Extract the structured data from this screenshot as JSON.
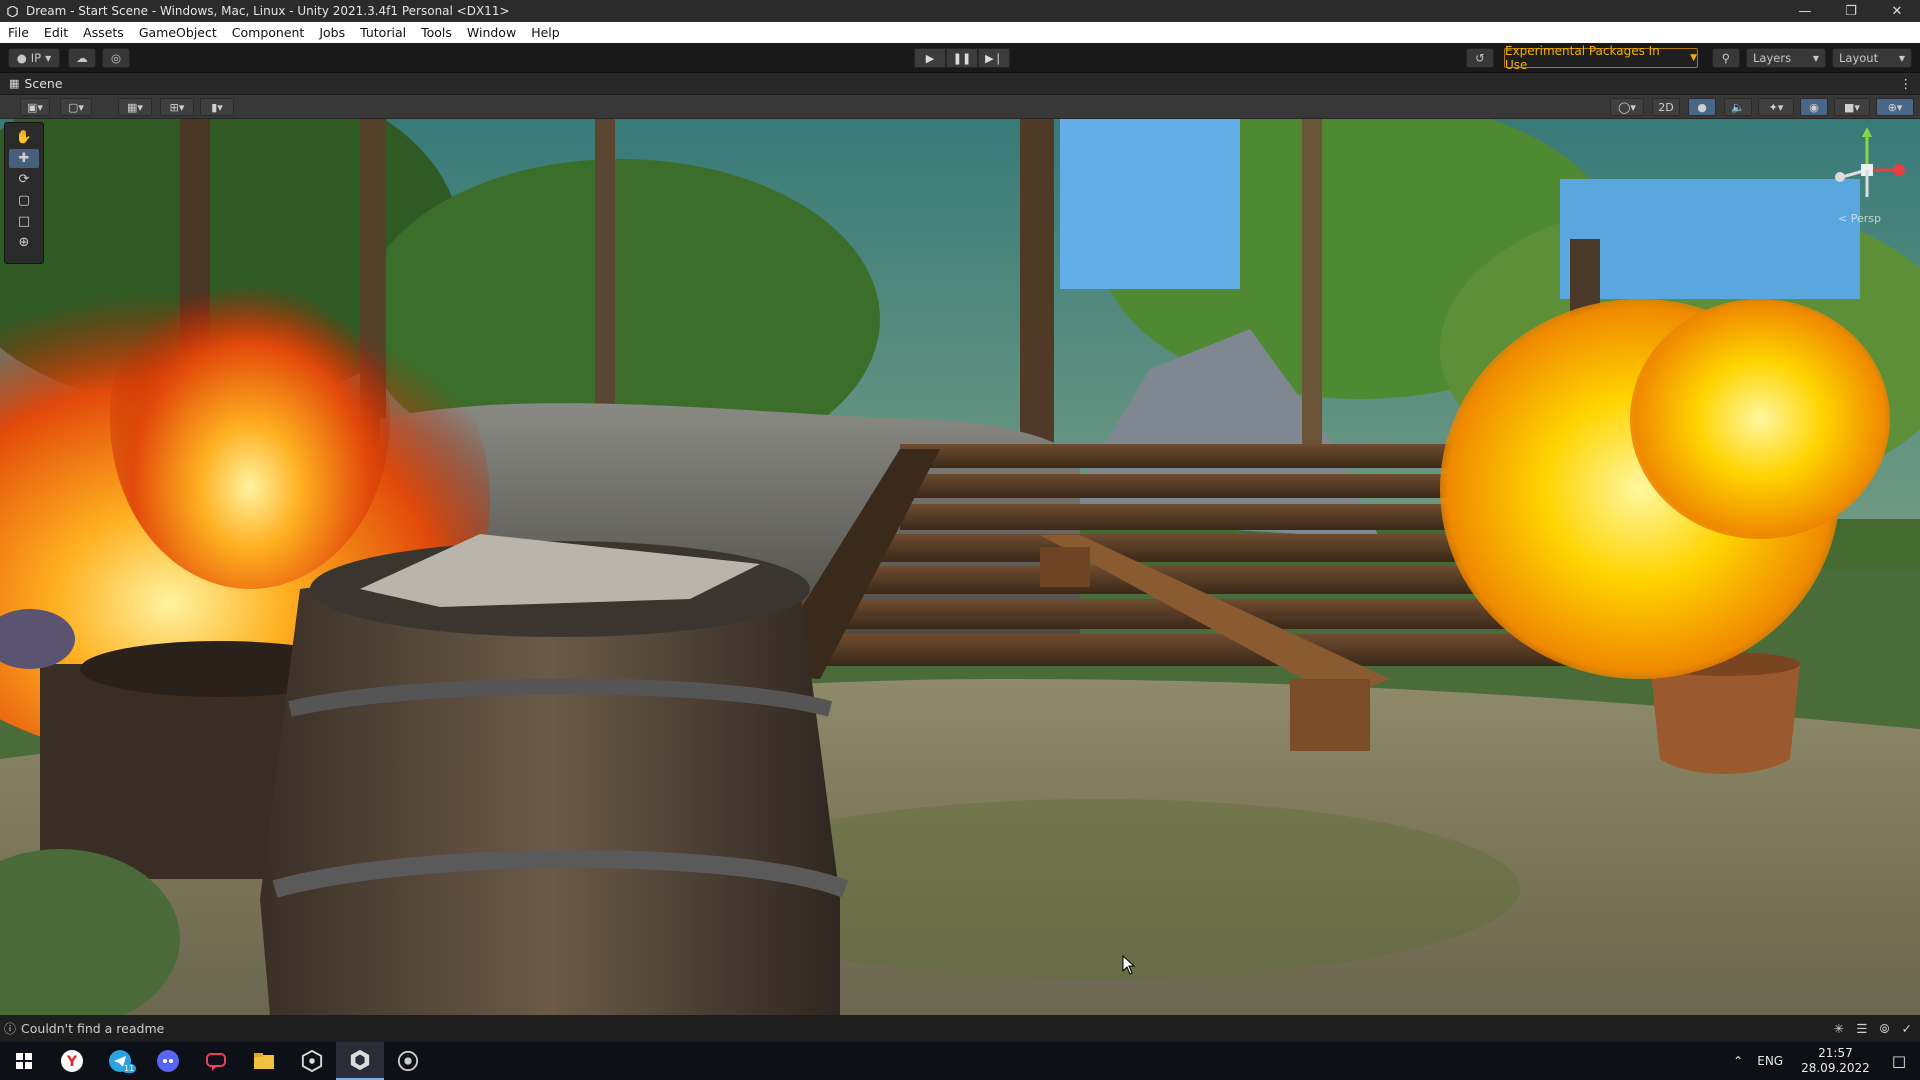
{
  "window": {
    "title": "Dream - Start Scene - Windows, Mac, Linux - Unity 2021.3.4f1 Personal <DX11>"
  },
  "menu": [
    "File",
    "Edit",
    "Assets",
    "GameObject",
    "Component",
    "Jobs",
    "Tutorial",
    "Tools",
    "Window",
    "Help"
  ],
  "toolbar": {
    "account_label": "IP",
    "experimental_label": "Experimental Packages In Use",
    "layers_label": "Layers",
    "layout_label": "Layout"
  },
  "scene": {
    "tab_label": "Scene",
    "mode_2d": "2D",
    "persp_label": "< Persp"
  },
  "status": {
    "message": "Couldn't find a readme"
  },
  "taskbar": {
    "lang": "ENG",
    "time": "21:57",
    "date": "28.09.2022",
    "telegram_badge": "11"
  }
}
